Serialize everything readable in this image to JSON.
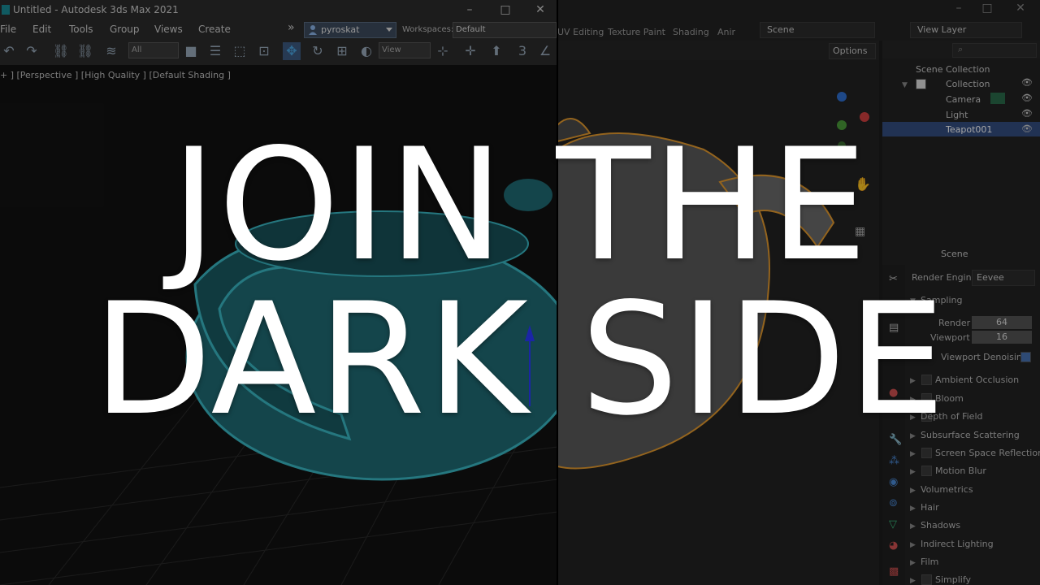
{
  "max": {
    "window_title": "Untitled - Autodesk 3ds Max 2021",
    "menu": [
      "File",
      "Edit",
      "Tools",
      "Group",
      "Views",
      "Create"
    ],
    "more_glyph": "»",
    "user": "pyroskat",
    "workspaces_label": "Workspaces:",
    "workspace_value": "Default",
    "selection_filter": "All",
    "reference_coord": "View",
    "viewport_label": "+ ] [Perspective ] [High Quality ] [Default Shading ]",
    "teapot_color": "#1f6a73"
  },
  "blender": {
    "tabs": [
      "UV Editing",
      "Texture Paint",
      "Shading",
      "Anir"
    ],
    "scene_field": "Scene",
    "view_layer": "View Layer",
    "options_label": "Options",
    "outliner": {
      "root": "Scene Collection",
      "collection": "Collection",
      "items": [
        "Camera",
        "Light",
        "Teapot001"
      ]
    },
    "props": {
      "header": "Scene",
      "render_engine_label": "Render Engine",
      "render_engine_value": "Eevee",
      "sampling": "Sampling",
      "render_label": "Render",
      "render_value": "64",
      "viewport_label": "Viewport",
      "viewport_value": "16",
      "viewport_denoising": "Viewport Denoising",
      "panels": [
        "Ambient Occlusion",
        "Bloom",
        "Depth of Field",
        "Subsurface Scattering",
        "Screen Space Reflections",
        "Motion Blur",
        "Volumetrics",
        "Hair",
        "Shadows",
        "Indirect Lighting",
        "Film",
        "Simplify"
      ]
    },
    "teapot_color": "#5a5a5a",
    "outline_color": "#e39a2e",
    "accent": "#4772b3"
  },
  "headline": {
    "line1": "JOIN THE",
    "line2": "DARK SIDE"
  }
}
